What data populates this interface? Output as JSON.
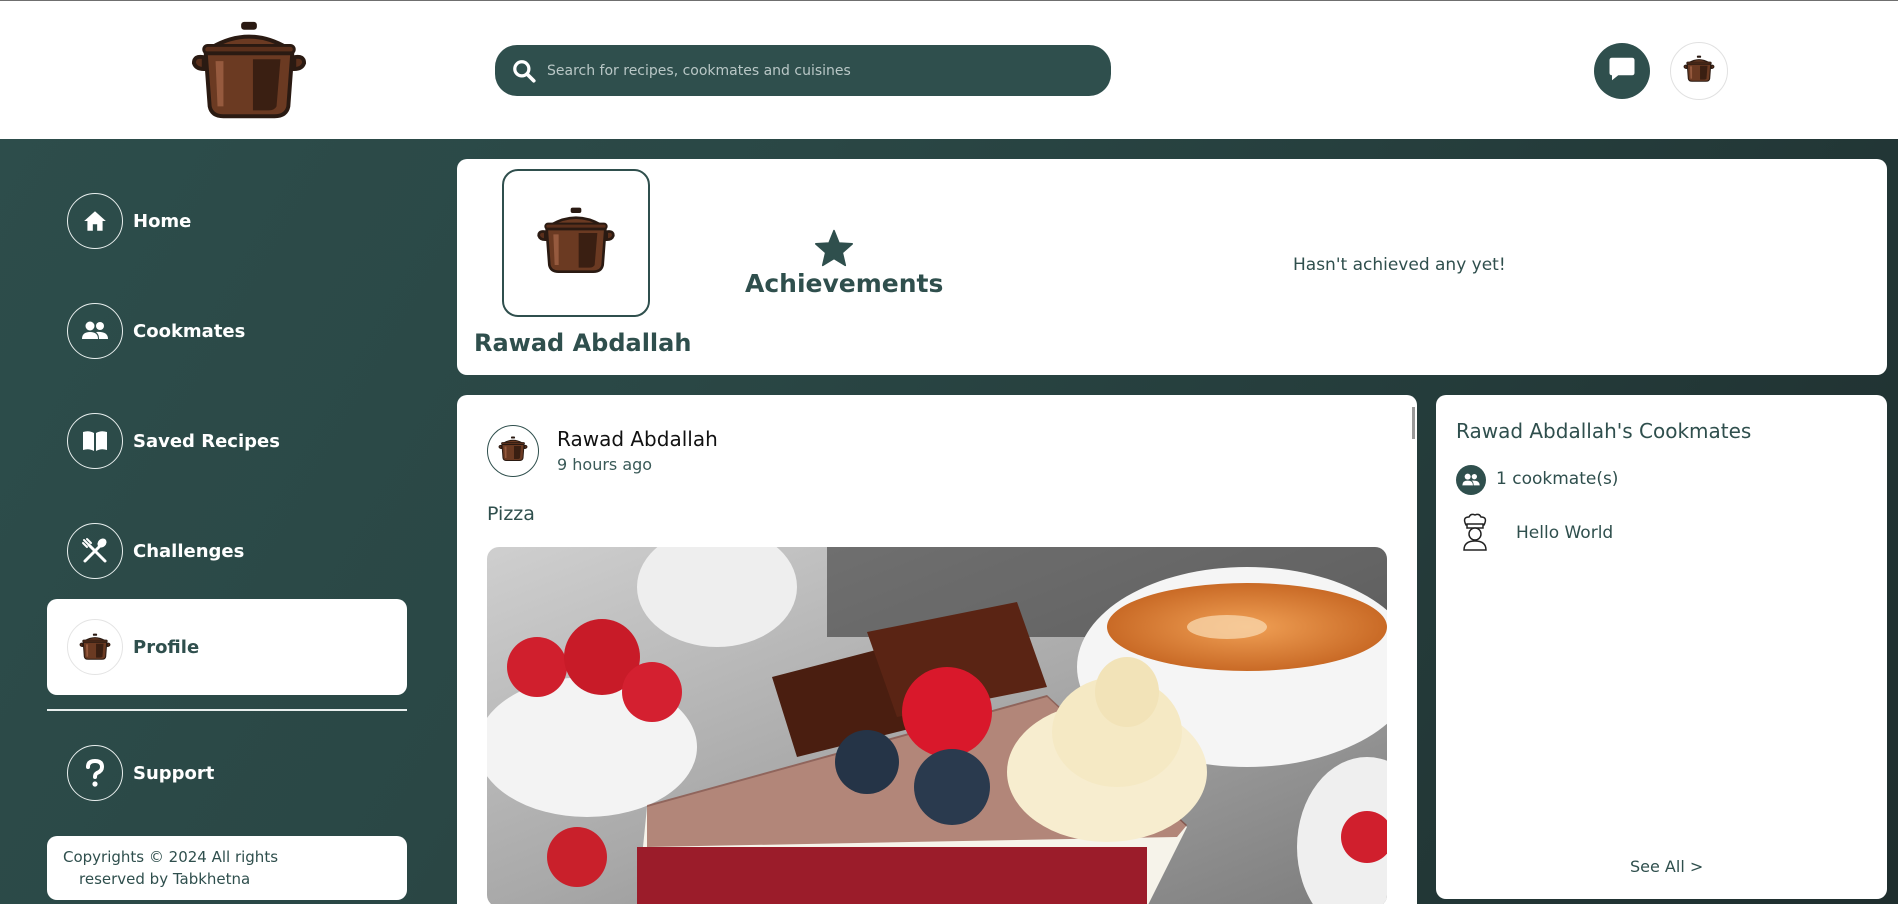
{
  "colors": {
    "primary": "#2f4f4d",
    "card": "#ffffff",
    "pot_brown": "#6b3a22"
  },
  "header": {
    "logo_icon": "cooking-pot-icon",
    "search": {
      "placeholder": "Search for recipes, cookmates and cuisines",
      "icon": "search-icon"
    },
    "messages_icon": "chat-bubble-icon",
    "profile_icon": "cooking-pot-icon"
  },
  "sidebar": {
    "items": [
      {
        "label": "Home",
        "icon": "home-icon"
      },
      {
        "label": "Cookmates",
        "icon": "users-icon"
      },
      {
        "label": "Saved Recipes",
        "icon": "book-icon"
      },
      {
        "label": "Challenges",
        "icon": "utensils-icon"
      },
      {
        "label": "Profile",
        "icon": "cooking-pot-icon",
        "active": true
      },
      {
        "label": "Support",
        "icon": "question-icon"
      }
    ],
    "copyright_line1": "Copyrights © 2024 All rights",
    "copyright_line2": "reserved by Tabkhetna"
  },
  "profile": {
    "name": "Rawad Abdallah",
    "achievements_title": "Achievements",
    "achievements_empty": "Hasn't achieved any yet!"
  },
  "post": {
    "author": "Rawad Abdallah",
    "time": "9 hours ago",
    "text": "Pizza",
    "image_desc": "red-velvet-cake-photo"
  },
  "cookmates": {
    "title": "Rawad Abdallah's Cookmates",
    "count_label": "1 cookmate(s)",
    "items": [
      {
        "name": "Hello World",
        "icon": "chef-icon"
      }
    ],
    "see_all": "See All >"
  }
}
